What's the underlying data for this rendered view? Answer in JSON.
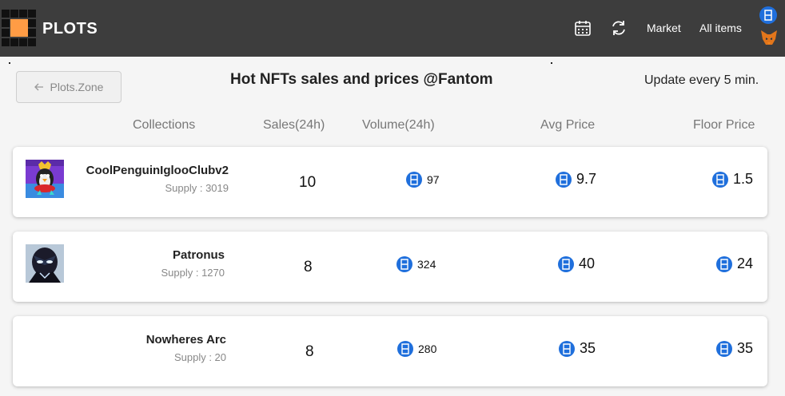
{
  "header": {
    "brand": "PLOTS",
    "nav_market": "Market",
    "nav_all_items": "All items",
    "logo_color": "#ff9c45",
    "bar_color": "#3d3d3d"
  },
  "toolbar": {
    "back_label": "Plots.Zone",
    "title": "Hot NFTs sales and prices @Fantom",
    "update_note": "Update every 5 min."
  },
  "columns": {
    "collections": "Collections",
    "sales": "Sales(24h)",
    "volume": "Volume(24h)",
    "avg_price": "Avg Price",
    "floor_price": "Floor Price"
  },
  "accent_color": "#1f6fdc",
  "rows": [
    {
      "name": "CoolPenguinIglooClubv2",
      "supply": "Supply : 3019",
      "sales": "10",
      "volume": "97",
      "avg": "9.7",
      "floor": "1.5"
    },
    {
      "name": "Patronus",
      "supply": "Supply : 1270",
      "sales": "8",
      "volume": "324",
      "avg": "40",
      "floor": "24"
    },
    {
      "name": "Nowheres Arc",
      "supply": "Supply : 20",
      "sales": "8",
      "volume": "280",
      "avg": "35",
      "floor": "35"
    }
  ]
}
